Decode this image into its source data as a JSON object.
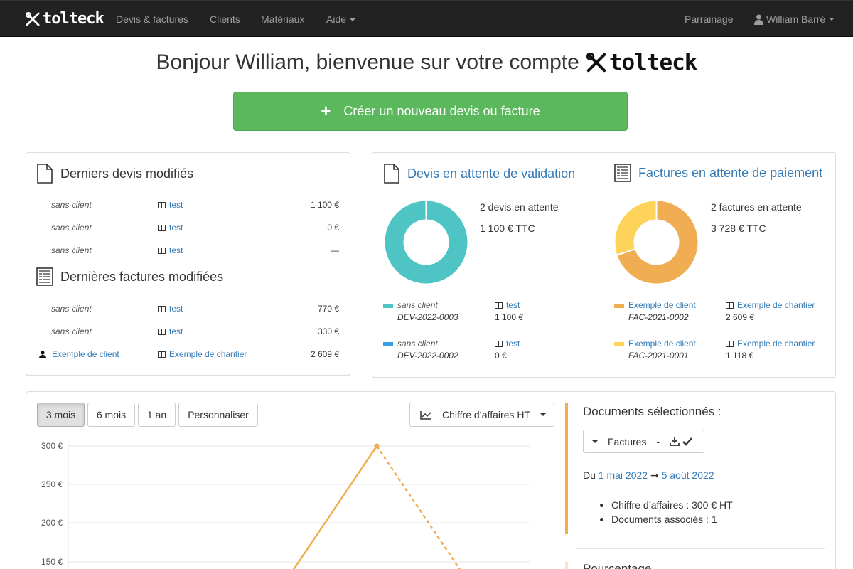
{
  "navbar": {
    "brand": "tolteck",
    "items": [
      "Devis & factures",
      "Clients",
      "Matériaux",
      "Aide"
    ],
    "parrainage": "Parrainage",
    "user": "William Barré"
  },
  "welcome": {
    "text": "Bonjour William, bienvenue sur votre compte",
    "logo": "tolteck"
  },
  "create_button": "Créer un nouveau devis ou facture",
  "recent_quotes": {
    "title": "Derniers devis modifiés",
    "rows": [
      {
        "client": "sans client",
        "chantier": "test",
        "amount": "1 100 €"
      },
      {
        "client": "sans client",
        "chantier": "test",
        "amount": "0 €"
      },
      {
        "client": "sans client",
        "chantier": "test",
        "amount": "—"
      }
    ]
  },
  "recent_invoices": {
    "title": "Dernières factures modifiées",
    "rows": [
      {
        "client": "sans client",
        "chantier": "test",
        "amount": "770 €"
      },
      {
        "client": "sans client",
        "chantier": "test",
        "amount": "330 €"
      },
      {
        "client": "Exemple de client",
        "chantier": "Exemple de chantier",
        "amount": "2 609 €"
      }
    ]
  },
  "pending_quotes": {
    "title": "Devis en attente de validation",
    "count_text": "2 devis en attente",
    "total_text": "1 100 € TTC",
    "chart_data": {
      "type": "pie",
      "values": [
        1100,
        0
      ],
      "colors": [
        "#4ec4c4",
        "#3a9fe0"
      ]
    },
    "legend": [
      {
        "client": "sans client",
        "ref": "DEV-2022-0003",
        "chantier": "test",
        "amount": "1 100 €",
        "color": "#4ec4c4"
      },
      {
        "client": "sans client",
        "ref": "DEV-2022-0002",
        "chantier": "test",
        "amount": "0 €",
        "color": "#3a9fe0"
      }
    ]
  },
  "pending_invoices": {
    "title": "Factures en attente de paiement",
    "count_text": "2 factures en attente",
    "total_text": "3 728 € TTC",
    "chart_data": {
      "type": "pie",
      "values": [
        2609,
        1118
      ],
      "colors": [
        "#f0ad52",
        "#fdd35a"
      ]
    },
    "legend": [
      {
        "client": "Exemple de client",
        "ref": "FAC-2021-0002",
        "chantier": "Exemple de chantier",
        "amount": "2 609 €",
        "color": "#f0ad52"
      },
      {
        "client": "Exemple de client",
        "ref": "FAC-2021-0001",
        "chantier": "Exemple de chantier",
        "amount": "1 118 €",
        "color": "#fdd35a"
      }
    ]
  },
  "period_buttons": [
    "3 mois",
    "6 mois",
    "1 an",
    "Personnaliser"
  ],
  "metric_select": "Chiffre d’affaires HT",
  "revenue_chart": {
    "chart_data": {
      "type": "line",
      "ylim": [
        0,
        300
      ],
      "y_ticks": [
        "300 €",
        "250 €",
        "200 €",
        "150 €"
      ],
      "color": "#f0ad4e"
    }
  },
  "selected_docs": {
    "title": "Documents sélectionnés :",
    "filter_label": "Factures",
    "filter_sep": "-",
    "period_prefix": "Du",
    "date_from": "1 mai 2022",
    "arrow": "➞",
    "date_to": "5 août 2022",
    "revenue": "Chiffre d’affaires : 300 € HT",
    "doc_count": "Documents associés : 1",
    "next_title": "Pourcentage"
  }
}
